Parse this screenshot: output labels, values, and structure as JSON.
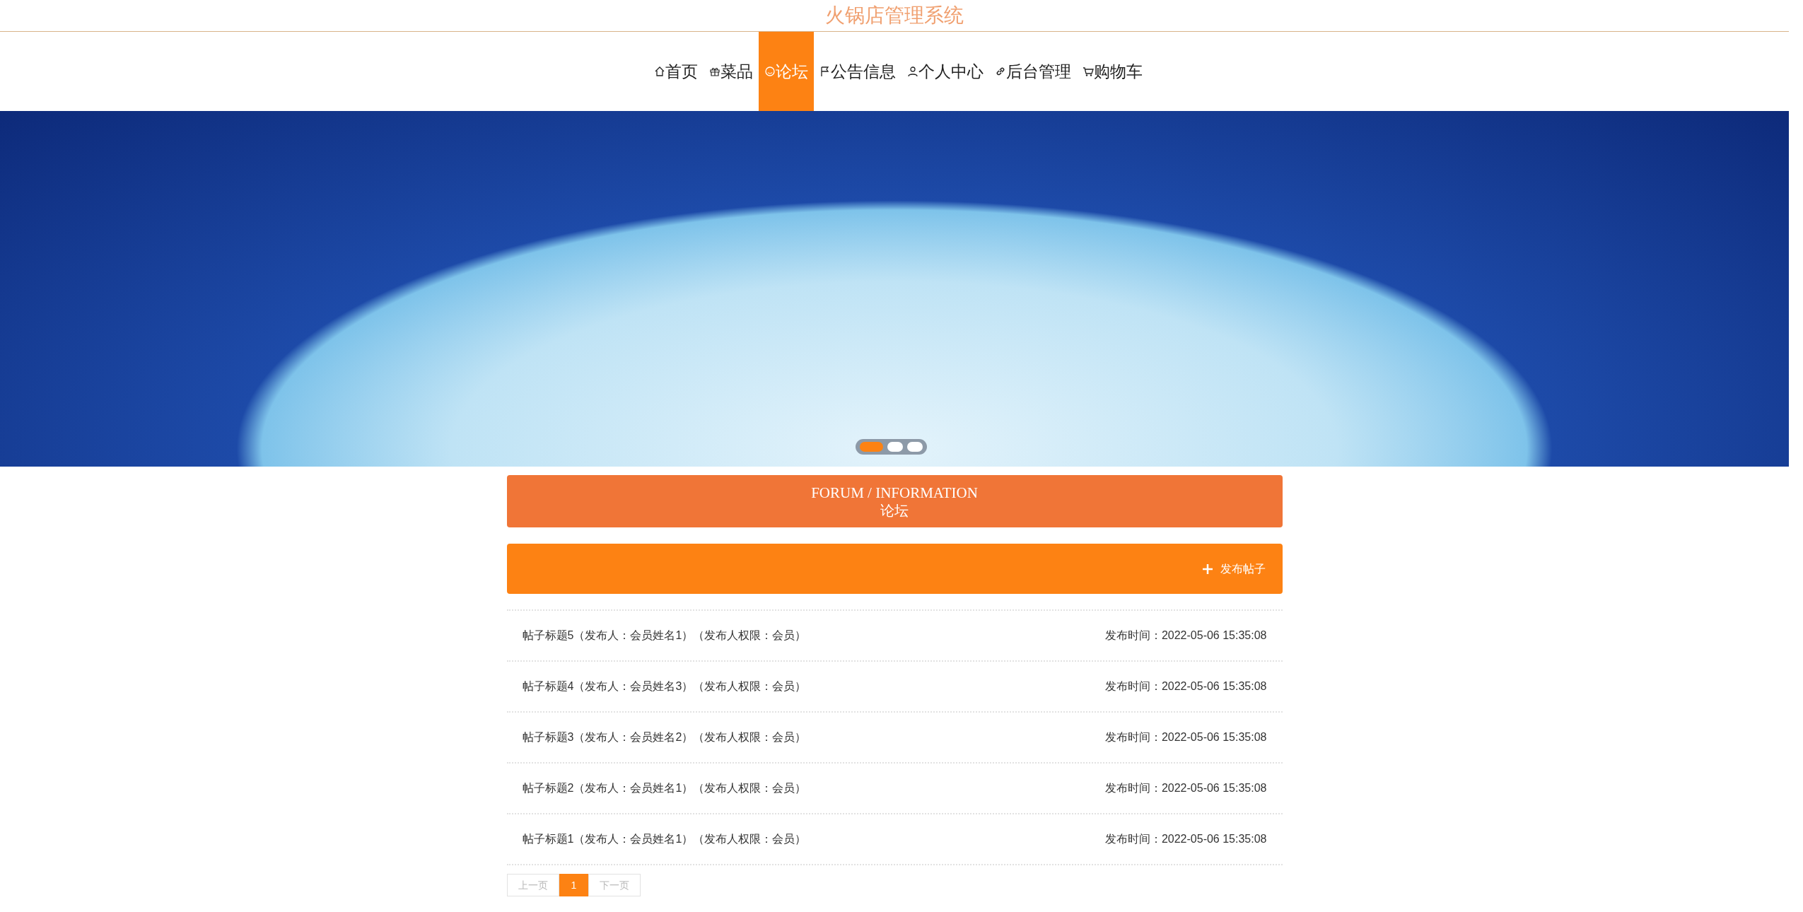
{
  "site_title": "火锅店管理系统",
  "nav": [
    {
      "label": "首页",
      "kind": "home",
      "selected": false
    },
    {
      "label": "菜品",
      "kind": "gift",
      "selected": false
    },
    {
      "label": "论坛",
      "kind": "smile",
      "selected": true
    },
    {
      "label": "公告信息",
      "kind": "flag",
      "selected": false
    },
    {
      "label": "个人中心",
      "kind": "user",
      "selected": false
    },
    {
      "label": "后台管理",
      "kind": "link",
      "selected": false
    },
    {
      "label": "购物车",
      "kind": "cart",
      "selected": false
    }
  ],
  "carousel_dots": [
    {
      "selected": true
    },
    {
      "selected": false
    },
    {
      "selected": false
    }
  ],
  "section_header": {
    "title": "FORUM / INFORMATION",
    "subtitle": "论坛"
  },
  "toolbar": {
    "add_button": "发布帖子"
  },
  "posts": [
    {
      "title": "帖子标题5（发布人：会员姓名1）（发布人权限：会员）",
      "time": "发布时间：2022-05-06 15:35:08"
    },
    {
      "title": "帖子标题4（发布人：会员姓名3）（发布人权限：会员）",
      "time": "发布时间：2022-05-06 15:35:08"
    },
    {
      "title": "帖子标题3（发布人：会员姓名2）（发布人权限：会员）",
      "time": "发布时间：2022-05-06 15:35:08"
    },
    {
      "title": "帖子标题2（发布人：会员姓名1）（发布人权限：会员）",
      "time": "发布时间：2022-05-06 15:35:08"
    },
    {
      "title": "帖子标题1（发布人：会员姓名1）（发布人权限：会员）",
      "time": "发布时间：2022-05-06 15:35:08"
    }
  ],
  "pagination": [
    {
      "label": "上一页",
      "selected": false
    },
    {
      "label": "1",
      "selected": true
    },
    {
      "label": "下一页",
      "selected": false
    }
  ]
}
